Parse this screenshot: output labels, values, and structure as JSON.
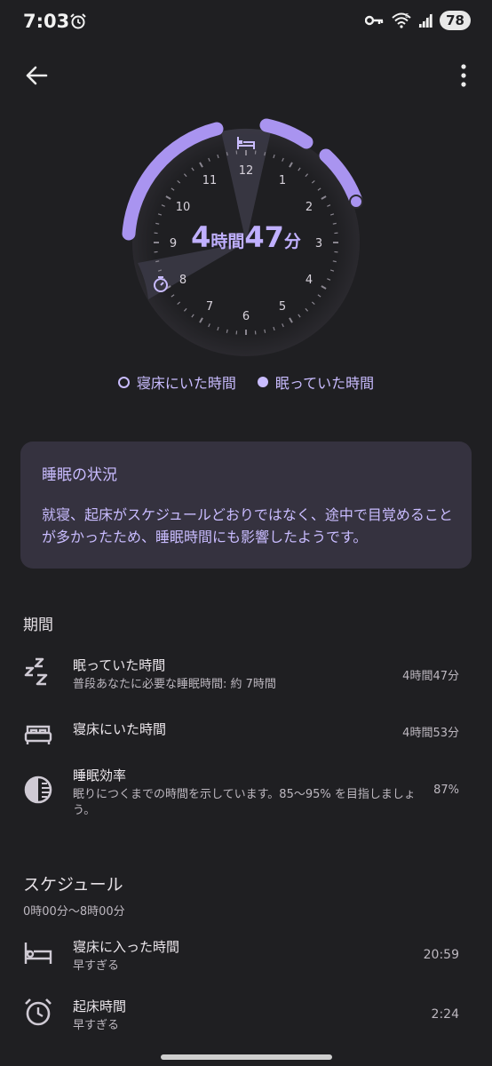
{
  "status": {
    "time": "7:03",
    "battery": "78",
    "signal": "6"
  },
  "dial": {
    "hours": "4",
    "hours_unit": "時間",
    "minutes": "47",
    "minutes_unit": "分",
    "numbers": [
      "12",
      "1",
      "2",
      "3",
      "4",
      "5",
      "6",
      "7",
      "8",
      "9",
      "10",
      "11"
    ],
    "accent_color": "#a994f0"
  },
  "legend": {
    "in_bed": "寝床にいた時間",
    "asleep": "眠っていた時間"
  },
  "card": {
    "title": "睡眠の状況",
    "body": "就寝、起床がスケジュールどおりではなく、途中で目覚めることが多かったため、睡眠時間にも影響したようです。"
  },
  "period": {
    "title": "期間",
    "rows": [
      {
        "icon": "zzz-icon",
        "label": "眠っていた時間",
        "sub": "普段あなたに必要な睡眠時間: 約 7時間",
        "value": "4時間47分"
      },
      {
        "icon": "bed-icon",
        "label": "寝床にいた時間",
        "sub": "",
        "value": "4時間53分"
      },
      {
        "icon": "efficiency-icon",
        "label": "睡眠効率",
        "sub": "眠りにつくまでの時間を示しています。85～95% を目指しましょう。",
        "value": "87%"
      }
    ]
  },
  "schedule": {
    "title": "スケジュール",
    "range": "0時00分～8時00分",
    "rows": [
      {
        "icon": "bed-icon",
        "label": "寝床に入った時間",
        "sub": "早すぎる",
        "value": "20:59"
      },
      {
        "icon": "alarm-icon",
        "label": "起床時間",
        "sub": "早すぎる",
        "value": "2:24"
      }
    ]
  }
}
